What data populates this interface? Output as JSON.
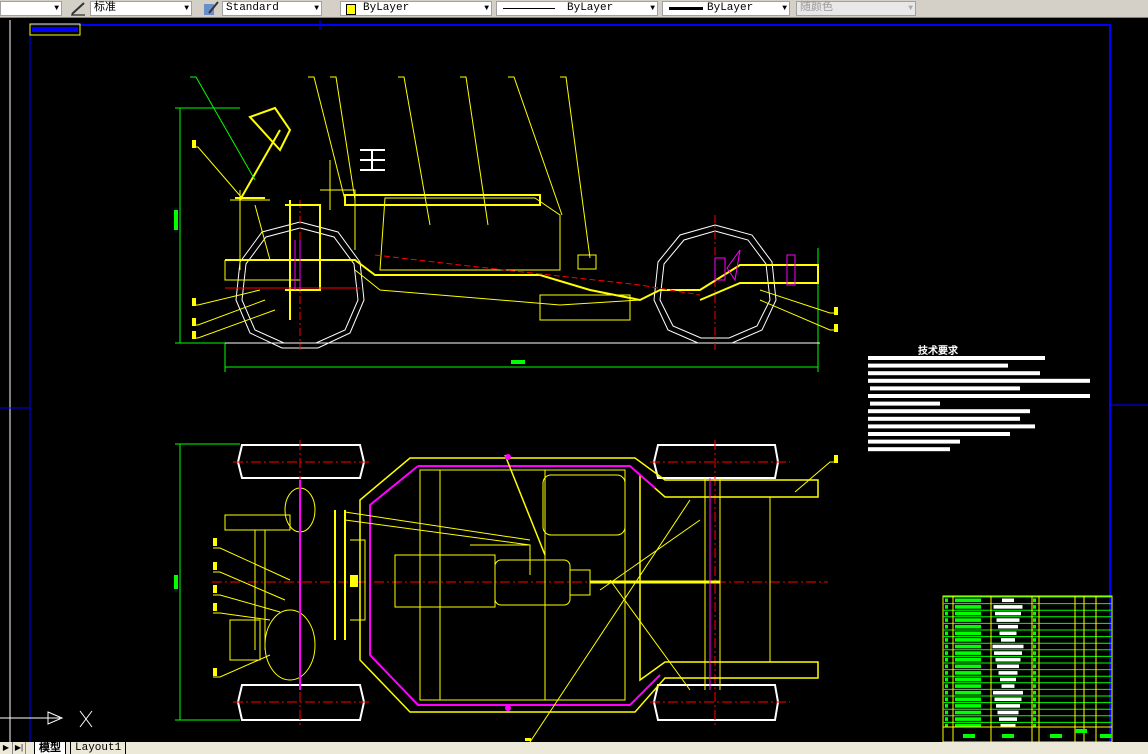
{
  "toolbar": {
    "text_style": "标准",
    "dim_style": "Standard",
    "color": "ByLayer",
    "linetype": "ByLayer",
    "lineweight": "ByLayer",
    "plot_style": "随颜色",
    "color_swatch": "#ffff00"
  },
  "drawing": {
    "tech_title": "技术要求",
    "colors": {
      "frame": "#ffff00",
      "center": "#ff0000",
      "wire": "#ff00ff",
      "tire": "#ffffff",
      "dimension": "#00ff00",
      "border": "#0000ff"
    }
  },
  "tabs": {
    "model": "模型",
    "layout1": "Layout1"
  }
}
